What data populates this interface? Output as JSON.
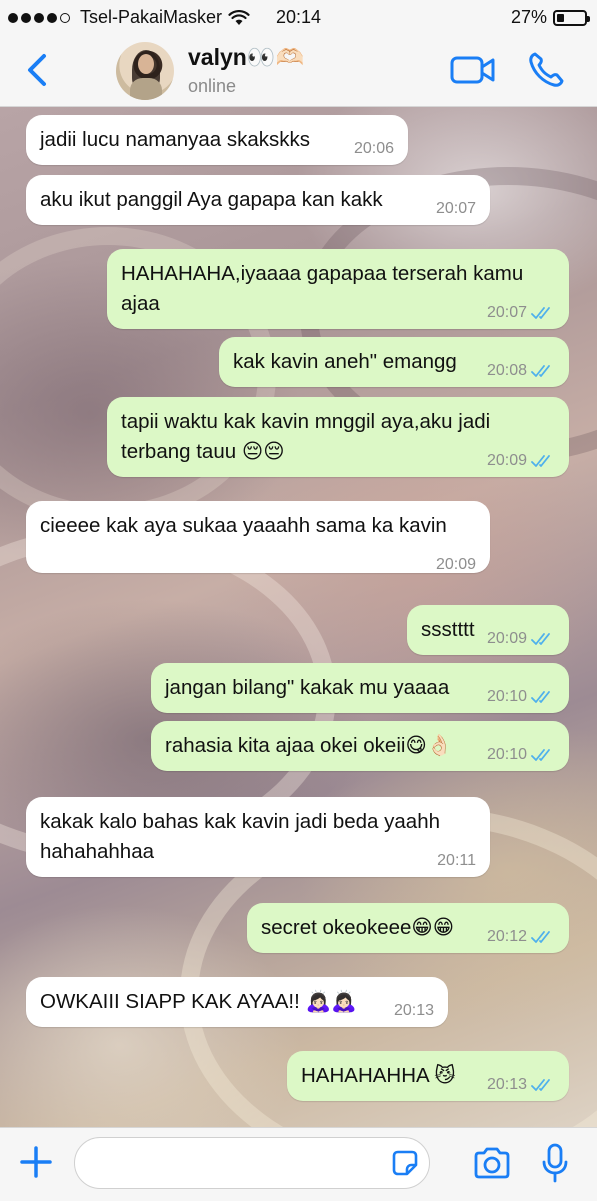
{
  "status_bar": {
    "carrier": "Tsel-PakaiMasker",
    "time": "20:14",
    "battery": "27%",
    "battery_level": 0.27,
    "signal_bars_filled": 4,
    "signal_bars_total": 5
  },
  "header": {
    "contact_name": "valyn👀🫶🏻",
    "contact_status": "online"
  },
  "messages": [
    {
      "dir": "in",
      "text": "jadii lucu namanyaa skakskks",
      "time": "20:06"
    },
    {
      "dir": "in",
      "text": "aku ikut panggil Aya gapapa kan kakk",
      "time": "20:07"
    },
    {
      "dir": "out",
      "text": "HAHAHAHA,iyaaaa gapapaa terserah kamu ajaa",
      "time": "20:07",
      "read": true
    },
    {
      "dir": "out",
      "text": "kak kavin aneh\" emangg",
      "time": "20:08",
      "read": true
    },
    {
      "dir": "out",
      "text": "tapii waktu kak kavin mnggil aya,aku jadi terbang tauu 😔😔",
      "time": "20:09",
      "read": true
    },
    {
      "dir": "in",
      "text": "cieeee kak aya sukaa yaaahh sama ka kavin",
      "time": "20:09"
    },
    {
      "dir": "out",
      "text": "ssstttt",
      "time": "20:09",
      "read": true
    },
    {
      "dir": "out",
      "text": "jangan bilang\" kakak mu yaaaa",
      "time": "20:10",
      "read": true
    },
    {
      "dir": "out",
      "text": "rahasia kita ajaa okei okeii😋👌🏻",
      "time": "20:10",
      "read": true
    },
    {
      "dir": "in",
      "text": "kakak kalo bahas kak kavin jadi beda yaahh hahahahhaa",
      "time": "20:11"
    },
    {
      "dir": "out",
      "text": "secret okeokeee😁😁",
      "time": "20:12",
      "read": true
    },
    {
      "dir": "in",
      "text": "OWKAIII SIAPP KAK AYAA!! 🙇🏻‍♀️🙇🏻‍♀️",
      "time": "20:13"
    },
    {
      "dir": "out",
      "text": "HAHAHAHHA 😼",
      "time": "20:13",
      "read": true
    }
  ],
  "input": {
    "value": "",
    "placeholder": ""
  },
  "colors": {
    "accent": "#1a7ef5",
    "outgoing_bubble": "#dcf8c6",
    "incoming_bubble": "#ffffff",
    "read_ticks": "#4fb0ec"
  },
  "icons": {
    "back": "chevron-left-icon",
    "video": "video-camera-icon",
    "call": "phone-icon",
    "plus": "plus-icon",
    "sticker": "sticker-icon",
    "camera": "camera-icon",
    "mic": "microphone-icon"
  }
}
